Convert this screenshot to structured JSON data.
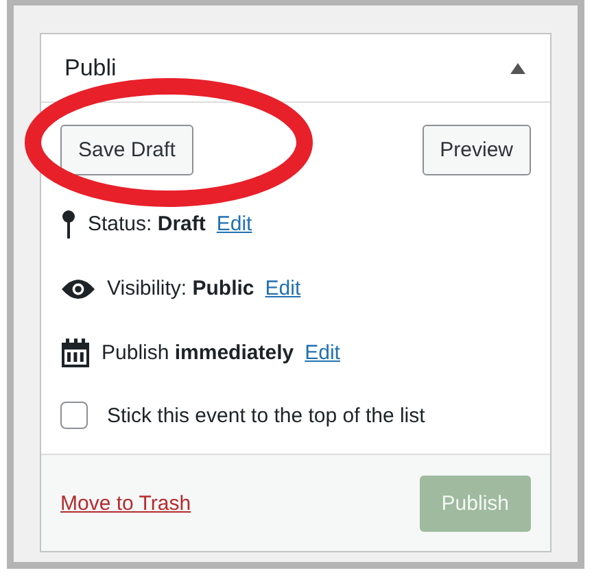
{
  "panel": {
    "title": "Publi",
    "expanded": true
  },
  "buttons": [
    {
      "label": "Save Draft"
    },
    {
      "label": "Preview"
    }
  ],
  "rows": [
    {
      "kind": "status",
      "label": "Status:",
      "value": "Draft",
      "link": "Edit"
    },
    {
      "kind": "visibility",
      "label": "Visibility:",
      "value": "Public",
      "link": "Edit"
    },
    {
      "kind": "schedule",
      "label": "Publish",
      "value": "immediately",
      "link": "Edit"
    }
  ],
  "sticky": {
    "label": "Stick this event to the top of the list",
    "checked": false
  },
  "footer": {
    "trash_link": "Move to Trash",
    "publish_button": {
      "label": "Publish",
      "disabled": true
    }
  },
  "annotation": {
    "kind": "ellipse",
    "color": "#e8202a"
  }
}
